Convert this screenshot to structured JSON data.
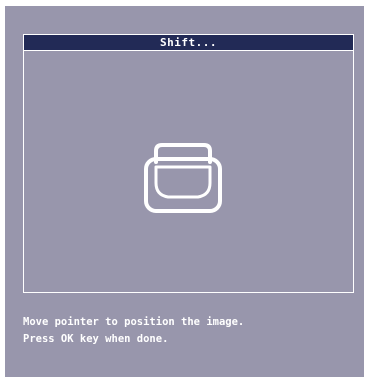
{
  "dialog": {
    "title": "Shift...",
    "icon": "image-shift-icon",
    "colors": {
      "background": "#9896ac",
      "title_bar": "#222a56",
      "text": "#ffffff"
    }
  },
  "instructions": {
    "line1": "Move pointer to position the image.",
    "line2": "Press OK key when done."
  }
}
